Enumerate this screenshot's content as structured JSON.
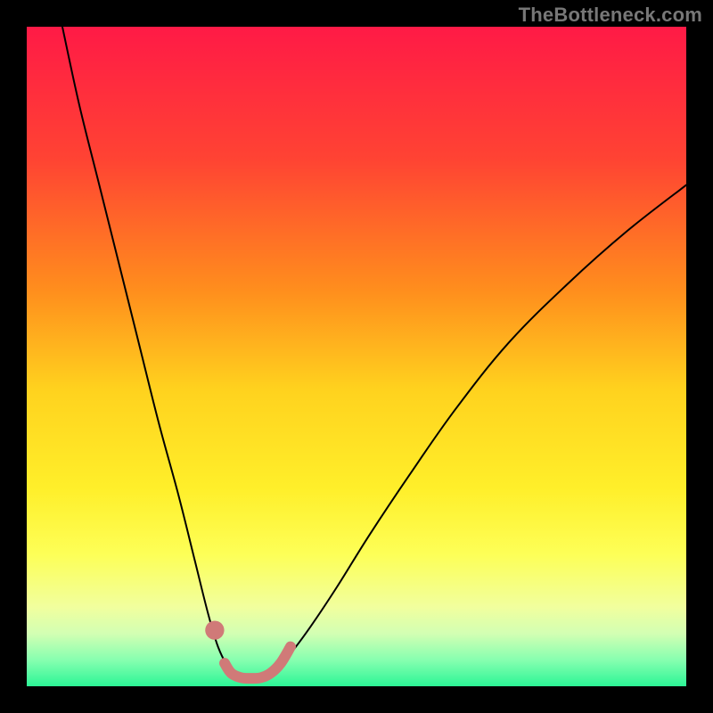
{
  "watermark": "TheBottleneck.com",
  "chart_data": {
    "type": "line",
    "title": "",
    "xlabel": "",
    "ylabel": "",
    "xlim": [
      0,
      100
    ],
    "ylim": [
      0,
      100
    ],
    "grid": false,
    "background_gradient_stops": [
      {
        "offset": 0,
        "color": "#ff1a46"
      },
      {
        "offset": 20,
        "color": "#ff4333"
      },
      {
        "offset": 40,
        "color": "#ff8e1d"
      },
      {
        "offset": 55,
        "color": "#ffd21e"
      },
      {
        "offset": 70,
        "color": "#ffef2a"
      },
      {
        "offset": 80,
        "color": "#fdff57"
      },
      {
        "offset": 88,
        "color": "#f1ff9e"
      },
      {
        "offset": 92,
        "color": "#d3ffb3"
      },
      {
        "offset": 96,
        "color": "#87ffb0"
      },
      {
        "offset": 100,
        "color": "#2cf596"
      }
    ],
    "series": [
      {
        "name": "left-arm",
        "stroke": "#000000",
        "stroke_width": 2,
        "points": [
          {
            "x": 5.4,
            "y": 100.0
          },
          {
            "x": 8.0,
            "y": 88.0
          },
          {
            "x": 11.0,
            "y": 76.0
          },
          {
            "x": 14.0,
            "y": 64.0
          },
          {
            "x": 17.0,
            "y": 52.0
          },
          {
            "x": 20.0,
            "y": 40.0
          },
          {
            "x": 23.0,
            "y": 29.0
          },
          {
            "x": 25.5,
            "y": 19.0
          },
          {
            "x": 27.5,
            "y": 11.0
          },
          {
            "x": 29.0,
            "y": 6.0
          },
          {
            "x": 30.5,
            "y": 3.0
          },
          {
            "x": 32.0,
            "y": 1.5
          },
          {
            "x": 33.0,
            "y": 1.0
          }
        ]
      },
      {
        "name": "right-arm",
        "stroke": "#000000",
        "stroke_width": 2,
        "points": [
          {
            "x": 33.0,
            "y": 1.0
          },
          {
            "x": 35.0,
            "y": 1.3
          },
          {
            "x": 37.5,
            "y": 2.5
          },
          {
            "x": 40.0,
            "y": 5.0
          },
          {
            "x": 43.0,
            "y": 9.0
          },
          {
            "x": 47.0,
            "y": 15.0
          },
          {
            "x": 52.0,
            "y": 23.0
          },
          {
            "x": 58.0,
            "y": 32.0
          },
          {
            "x": 65.0,
            "y": 42.0
          },
          {
            "x": 73.0,
            "y": 52.0
          },
          {
            "x": 82.0,
            "y": 61.0
          },
          {
            "x": 91.0,
            "y": 69.0
          },
          {
            "x": 100.0,
            "y": 76.0
          }
        ]
      },
      {
        "name": "trough-markers",
        "stroke": "#d07a78",
        "stroke_width": 12,
        "linecap": "round",
        "points": [
          {
            "x": 30.0,
            "y": 3.5
          },
          {
            "x": 31.0,
            "y": 2.0
          },
          {
            "x": 32.5,
            "y": 1.3
          },
          {
            "x": 34.0,
            "y": 1.2
          },
          {
            "x": 35.5,
            "y": 1.3
          },
          {
            "x": 37.0,
            "y": 2.0
          },
          {
            "x": 38.5,
            "y": 3.5
          },
          {
            "x": 40.0,
            "y": 6.0
          }
        ]
      }
    ],
    "isolated_marker": {
      "x": 28.5,
      "y": 8.5,
      "r": 1.0,
      "color": "#d07a78"
    }
  }
}
